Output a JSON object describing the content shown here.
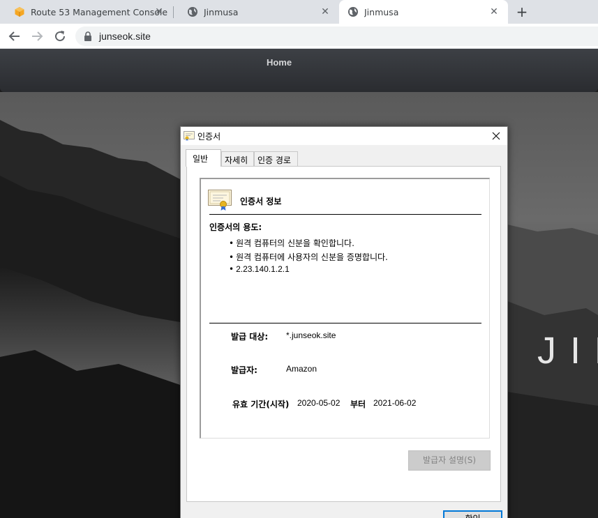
{
  "browser": {
    "tabs": [
      {
        "title": "Route 53 Management Console",
        "icon": "aws-icon"
      },
      {
        "title": "Jinmusa",
        "icon": "globe-icon"
      },
      {
        "title": "Jinmusa",
        "icon": "globe-icon",
        "active": true
      }
    ],
    "url": "junseok.site"
  },
  "site": {
    "nav_home": "Home",
    "hero_title": "JIN"
  },
  "dialog": {
    "title": "인증서",
    "tabs": [
      "일반",
      "자세히",
      "인증 경로"
    ],
    "info_heading": "인증서 정보",
    "purpose_heading": "인증서의 용도:",
    "purposes": [
      "원격 컴퓨터의 신분을 확인합니다.",
      "원격 컴퓨터에 사용자의 신분을 증명합니다.",
      "2.23.140.1.2.1"
    ],
    "issued_to_label": "발급 대상:",
    "issued_to": "*.junseok.site",
    "issued_by_label": "발급자:",
    "issued_by": "Amazon",
    "validity_label": "유효 기간(시작)",
    "valid_from": "2020-05-02",
    "to_label": "부터",
    "valid_to": "2021-06-02",
    "issuer_statement_button": "발급자 설명(S)",
    "ok_button": "확인"
  }
}
